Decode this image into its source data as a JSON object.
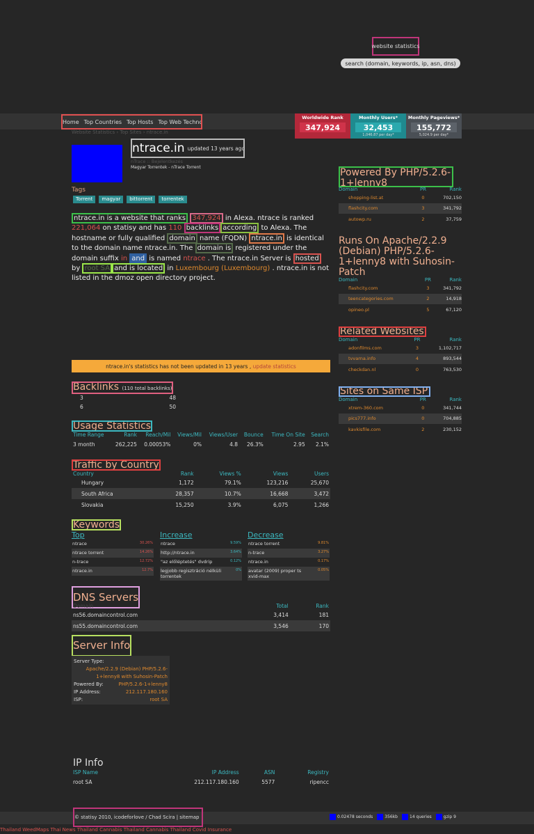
{
  "header": {
    "site_title": "website statistics",
    "search_placeholder": "search (domain, keywords, ip, asn, dns)"
  },
  "nav": [
    "Home",
    "Top Countries",
    "Top Hosts",
    "Top Web Technologies"
  ],
  "stats": {
    "worldwide_label": "Worldwide Rank",
    "worldwide_value": "347,924",
    "users_label": "Monthly Users*",
    "users_value": "32,453",
    "users_sub": "1,046.87 per day*",
    "pageviews_label": "Monthly Pageviews*",
    "pageviews_value": "155,772",
    "pageviews_sub": "5,024.9 per day*"
  },
  "breadcrumb": "Website Statistics  ›  Top Sites  ›  ntrace.in",
  "domain": {
    "name": "ntrace.in",
    "updated": "updated 13 years ago",
    "subtitle1": "nTrace :: Bejelentkezés",
    "subtitle2": "Magyar Torrentek - nTrace Torrent"
  },
  "tags_title": "Tags",
  "tags": [
    "Torrent",
    "magyar",
    "bittorrent",
    "torrentek"
  ],
  "para": {
    "p1": "ntrace.in is a website that ranks",
    "rank": "347,924",
    "p2": "in Alexa. ntrace",
    "p3": "is ranked",
    "statisy_rank": "221,064",
    "p4": "on statisy and has",
    "backlinks": "110",
    "p5": "backlinks",
    "p6": "according",
    "p7": "to Alexa. The hostname or fully qualified",
    "p8": "domain",
    "p9": "name (FQDN)",
    "p10": "ntrace.in",
    "p11": "is identical to the domain name ntrace.in. The",
    "p12": "domain is",
    "p13": "registered under the domain suffix",
    "suffix": "in",
    "p14": "and",
    "p15": "is named",
    "p16": "ntrace",
    "p17": ". The ntrace.in Server is",
    "p18": "hosted",
    "p19": "by",
    "host": "root SA",
    "p20": "and is located",
    "p21": "in",
    "location": "Luxembourg (Luxembourg)",
    "p22": ". ntrace.in is not listed in the dmoz open directory project."
  },
  "notice": {
    "text": "ntrace.in's statistics has not been updated in 13 years ,",
    "link": "update statistics"
  },
  "backlinks": {
    "title": "Backlinks",
    "count": "(110 total backlinks)",
    "rows": [
      [
        "3",
        "48"
      ],
      [
        "6",
        "50"
      ]
    ]
  },
  "usage": {
    "title": "Usage Statistics",
    "headers": [
      "Time Range",
      "Rank",
      "Reach/Mil",
      "Views/Mil",
      "Views/User",
      "Bounce",
      "Time On Site",
      "Search"
    ],
    "rows": [
      [
        "3 month",
        "262,225",
        "0.00053%",
        "0%",
        "4.8",
        "26.3%",
        "2.95",
        "2.1%"
      ]
    ]
  },
  "traffic": {
    "title": "Traffic by Country",
    "headers": [
      "Country",
      "Rank",
      "Views %",
      "Views",
      "Users"
    ],
    "rows": [
      [
        "Hungary",
        "1,172",
        "79.1%",
        "123,216",
        "25,670"
      ],
      [
        "South Africa",
        "28,357",
        "10.7%",
        "16,668",
        "3,472"
      ],
      [
        "Slovakia",
        "15,250",
        "3.9%",
        "6,075",
        "1,266"
      ]
    ]
  },
  "keywords": {
    "title": "Keywords",
    "top_title": "Top",
    "top": [
      [
        "ntrace",
        "30.26%"
      ],
      [
        "ntrace torrent",
        "14.26%"
      ],
      [
        "n-trace",
        "12.72%"
      ],
      [
        "ntrace.in",
        "12.7%"
      ]
    ],
    "inc_title": "Increase",
    "inc": [
      [
        "ntrace",
        "9.59%"
      ],
      [
        "http://ntrace.in",
        "3.64%"
      ],
      [
        "\"az előléptetés\" dvdrip",
        "0.12%"
      ],
      [
        "legjobb regisztráció nélküli torrentek",
        "0%"
      ]
    ],
    "dec_title": "Decrease",
    "dec": [
      [
        "ntrace torrent",
        "9.81%"
      ],
      [
        "n-trace",
        "3.27%"
      ],
      [
        "ntrace.in",
        "0.17%"
      ],
      [
        "avatar (2009) proper ts xvid-max",
        "0.05%"
      ]
    ]
  },
  "dns": {
    "title": "DNS Servers",
    "headers": [
      "Domain",
      "Total",
      "Rank"
    ],
    "rows": [
      [
        "ns56.domaincontrol.com",
        "3,414",
        "181"
      ],
      [
        "ns55.domaincontrol.com",
        "3,546",
        "170"
      ]
    ]
  },
  "server": {
    "title": "Server Info",
    "type_label": "Server Type:",
    "type_value": "Apache/2.2.9 (Debian) PHP/5.2.6-1+lenny8 with Suhosin-Patch",
    "powered_label": "Powered By:",
    "powered_value": "PHP/5.2.6-1+lenny8",
    "ip_label": "IP Address:",
    "ip_value": "212.117.180.160",
    "isp_label": "ISP:",
    "isp_value": "root SA"
  },
  "ipinfo": {
    "title": "IP Info",
    "headers": [
      "ISP Name",
      "IP Address",
      "ASN",
      "Registry"
    ],
    "row": [
      "root SA",
      "212.117.180.160",
      "5577",
      "ripencc"
    ]
  },
  "side": {
    "powered_title": "Powered By PHP/5.2.6-1+lenny8",
    "powered_rows": [
      [
        "shopping-list.at",
        "0",
        "702,150"
      ],
      [
        "flashcity.com",
        "3",
        "341,792"
      ],
      [
        "autowp.ru",
        "2",
        "37,759"
      ]
    ],
    "apache_title": "Runs On Apache/2.2.9 (Debian) PHP/5.2.6-1+lenny8 with Suhosin-Patch",
    "apache_rows": [
      [
        "flashcity.com",
        "3",
        "341,792"
      ],
      [
        "teencategories.com",
        "2",
        "14,918"
      ],
      [
        "opineo.pl",
        "5",
        "67,120"
      ]
    ],
    "related_title": "Related Websites",
    "related_rows": [
      [
        "adonfilms.com",
        "3",
        "1,102,717"
      ],
      [
        "tvvarna.info",
        "4",
        "893,544"
      ],
      [
        "checkdan.nl",
        "0",
        "763,530"
      ]
    ],
    "isp_title": "Sites on Same ISP",
    "isp_rows": [
      [
        "xtrem-360.com",
        "0",
        "341,744"
      ],
      [
        "pics777.info",
        "0",
        "704,885"
      ],
      [
        "kavkisfile.com",
        "2",
        "230,152"
      ]
    ],
    "col_domain": "Domain",
    "col_pr": "PR",
    "col_rank": "Rank"
  },
  "footer": {
    "left": "© statisy 2010, icodeforlove / Chad Scira | sitemap",
    "seconds": "0.02478 seconds",
    "size": "356kb",
    "queries": "14 queries",
    "gzip": "gzip 9",
    "links": "Thailand WeedMaps Thai News Thailand Cannabis Thailand Cannabis Thailand Covid Insurance"
  }
}
